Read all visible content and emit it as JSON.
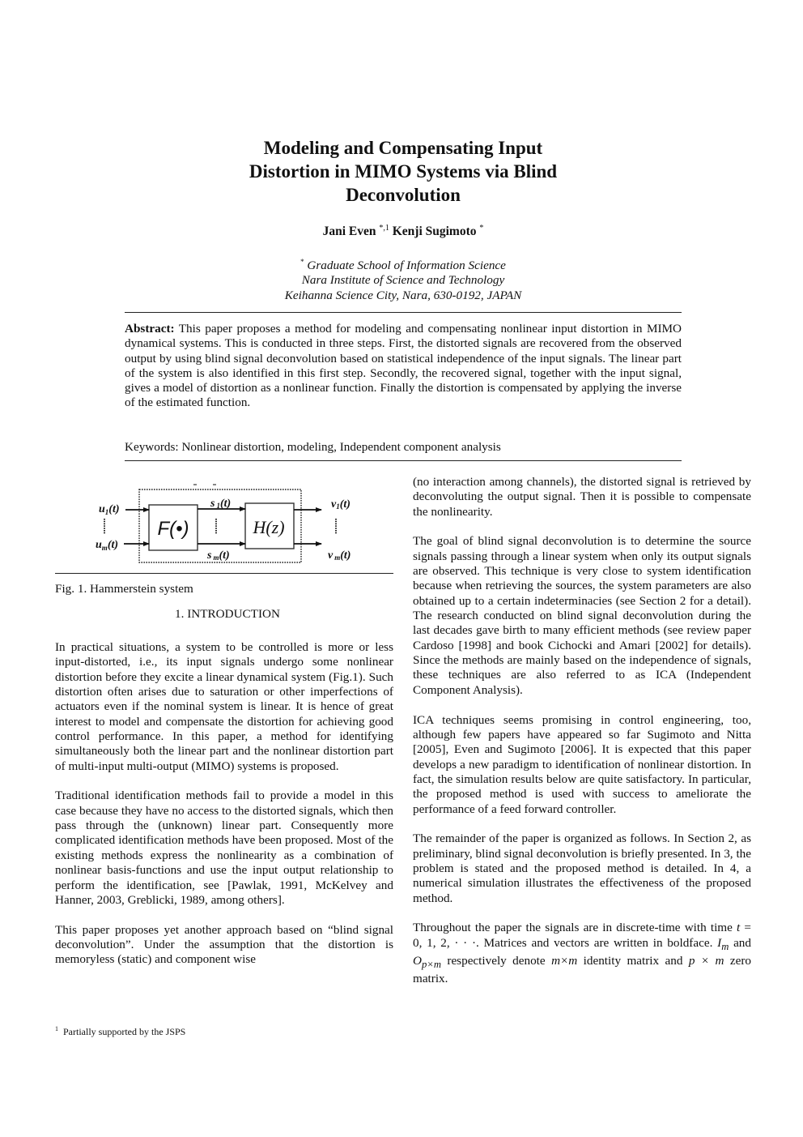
{
  "title": {
    "lines": [
      "Modeling and Compensating Input",
      "Distortion in MIMO Systems via Blind",
      "Deconvolution"
    ]
  },
  "authors": [
    {
      "name": "Jani Even",
      "marks": "*,1"
    },
    {
      "name": "Kenji Sugimoto",
      "marks": "*"
    }
  ],
  "affiliation": {
    "mark": "*",
    "lines": [
      "Graduate School of Information Science",
      "Nara Institute of Science and Technology",
      "Keihanna Science City, Nara, 630-0192, JAPAN"
    ]
  },
  "abstract": {
    "label": "Abstract:",
    "text": "This paper proposes a method for modeling and compensating nonlinear input distortion in MIMO dynamical systems. This is conducted in three steps. First, the distorted signals are recovered from the observed output by using blind signal deconvolution based on statistical independence of the input signals. The linear part of the system is also identified in this first step. Secondly, the recovered signal, together with the input signal, gives a model of distortion as a nonlinear function. Finally the distortion is compensated by applying the inverse of the estimated function."
  },
  "keywords": "Keywords: Nonlinear distortion, modeling, Independent component analysis",
  "figure": {
    "caption": "Fig. 1. Hammerstein system",
    "blocks": {
      "nonlinear": "F(•)",
      "linear": "H(z)"
    },
    "inputs": {
      "first": "u",
      "first_sub": "1",
      "last": "u",
      "last_sub": "m",
      "arg": "(t)"
    },
    "internal": {
      "first": "s",
      "first_sub": "1",
      "last": "s",
      "last_sub": "m",
      "arg": "(t)"
    },
    "outputs": {
      "first": "v",
      "first_sub": "1",
      "last": "v",
      "last_sub": "m",
      "arg": "(t)"
    }
  },
  "section": {
    "number": "1.",
    "title": "INTRODUCTION"
  },
  "left_column": {
    "paragraphs": [
      "In practical situations, a system to be controlled is more or less input-distorted, i.e., its input signals undergo some nonlinear distortion before they excite a linear dynamical system (Fig.1). Such distortion often arises due to saturation or other imperfections of actuators even if the nominal system is linear. It is hence of great interest to model and compensate the distortion for achieving good control performance. In this paper, a method for identifying simultaneously both the linear part and the nonlinear distortion part of multi-input multi-output (MIMO) systems is proposed.",
      "Traditional identification methods fail to provide a model in this case because they have no access to the distorted signals, which then pass through the (unknown) linear part. Consequently more complicated identification methods have been proposed. Most of the existing methods express the nonlinearity as a combination of nonlinear basis-functions and use the input output relationship to perform the identification, see [Pawlak, 1991, McKelvey and Hanner, 2003, Greblicki, 1989, among others].",
      "This paper proposes yet another approach based on “blind signal deconvolution”. Under the assumption that the distortion is memoryless (static) and component wise"
    ]
  },
  "right_column": {
    "paragraphs": [
      "(no interaction among channels), the distorted signal is retrieved by deconvoluting the output signal. Then it is possible to compensate the nonlinearity.",
      "The goal of blind signal deconvolution is to determine the source signals passing through a linear system when only its output signals are observed. This technique is very close to system identification because when retrieving the sources, the system parameters are also obtained up to a certain indeterminacies (see Section 2 for a detail). The research conducted on blind signal deconvolution during the last decades gave birth to many efficient methods (see review paper Cardoso [1998] and book Cichocki and Amari [2002] for details). Since the methods are mainly based on the independence of signals, these techniques are also referred to as ICA (Independent Component Analysis).",
      "ICA techniques seems promising in control engineering, too, although few papers have appeared so far Sugimoto and Nitta [2005], Even and Sugimoto [2006]. It is expected that this paper develops a new paradigm to identification of nonlinear distortion. In fact, the simulation results below are quite satisfactory. In particular, the proposed method is used with success to ameliorate the performance of a feed forward controller.",
      "The remainder of the paper is organized as follows. In Section 2, as preliminary, blind signal deconvolution is briefly presented. In 3, the problem is stated and the proposed method is detailed. In 4, a numerical simulation illustrates the effectiveness of the proposed method."
    ],
    "last_paragraph": {
      "t1": "Throughout the paper the signals are in discrete-time with time ",
      "math_t": "t",
      "t2": " = 0, 1, 2, · · ·. Matrices and vectors are written in boldface. ",
      "math_I": "I",
      "sub_I": "m",
      "t3": " and ",
      "math_O": "O",
      "sub_O": "p×m",
      "t4": " respectively denote ",
      "math_mxm": "m×m",
      "t5": " identity matrix and ",
      "math_pxm": "p × m",
      "t6": " zero matrix."
    }
  },
  "footnote": {
    "mark": "1",
    "text": "Partially supported by the JSPS"
  }
}
